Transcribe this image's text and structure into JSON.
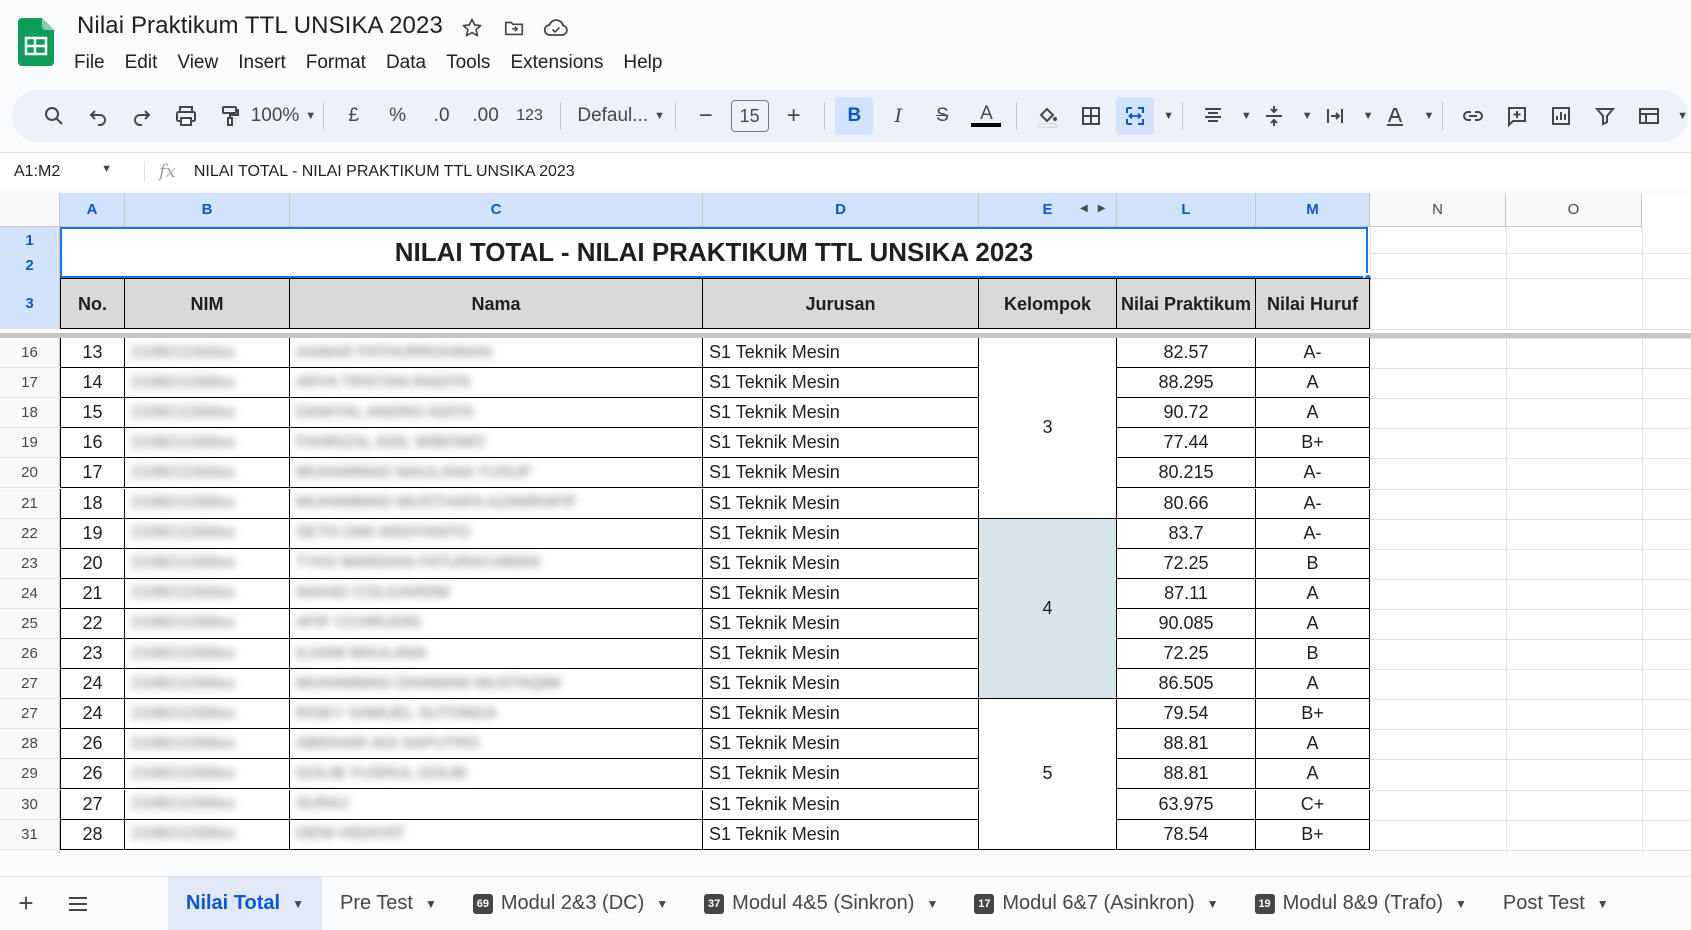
{
  "doc": {
    "title": "Nilai Praktikum TTL UNSIKA 2023",
    "menu": [
      "File",
      "Edit",
      "View",
      "Insert",
      "Format",
      "Data",
      "Tools",
      "Extensions",
      "Help"
    ]
  },
  "toolbar": {
    "zoom": "100%",
    "currency": "£",
    "percent": "%",
    "dec_decrease": ".0",
    "dec_increase": ".00",
    "number_format": "123",
    "font": "Defaul...",
    "font_size": "15",
    "minus": "−",
    "plus": "+",
    "bold": "B",
    "italic": "I",
    "strike": "S",
    "text_color": "A"
  },
  "formula_bar": {
    "name_box": "A1:M2",
    "fx": "fx",
    "content": "NILAI TOTAL - NILAI PRAKTIKUM TTL UNSIKA 2023"
  },
  "columns": [
    "A",
    "B",
    "C",
    "D",
    "E",
    "L",
    "M",
    "N",
    "O"
  ],
  "sheet": {
    "title": "NILAI TOTAL - NILAI PRAKTIKUM TTL UNSIKA 2023",
    "headers": [
      "No.",
      "NIM",
      "Nama",
      "Jurusan",
      "Kelompok",
      "Nilai Praktikum",
      "Nilai Huruf"
    ],
    "header_rows": [
      "1",
      "2",
      "3"
    ],
    "rows": [
      {
        "r": "16",
        "no": "13",
        "nim": "2108211500xx",
        "nama": "AAMAR FATHURROHMAN",
        "jurusan": "S1 Teknik Mesin",
        "nilai": "82.57",
        "huruf": "A-"
      },
      {
        "r": "17",
        "no": "14",
        "nim": "2108211500xx",
        "nama": "ARYA TRISTAN RADITA",
        "jurusan": "S1 Teknik Mesin",
        "nilai": "88.295",
        "huruf": "A"
      },
      {
        "r": "18",
        "no": "15",
        "nim": "2108211500xx",
        "nama": "DANIYAL ANDRO ADITA",
        "jurusan": "S1 Teknik Mesin",
        "nilai": "90.72",
        "huruf": "A"
      },
      {
        "r": "19",
        "no": "16",
        "nim": "2108211500xx",
        "nama": "FAHRIZAL ADIL WIBOWO",
        "jurusan": "S1 Teknik Mesin",
        "nilai": "77.44",
        "huruf": "B+"
      },
      {
        "r": "20",
        "no": "17",
        "nim": "2108211500xx",
        "nama": "MUHAMMAD MAULANA YUSUF",
        "jurusan": "S1 Teknik Mesin",
        "nilai": "80.215",
        "huruf": "A-"
      },
      {
        "r": "21",
        "no": "18",
        "nim": "2108211500xx",
        "nama": "MUHAMMAD MUSTHAFA AZAMRAFIF",
        "jurusan": "S1 Teknik Mesin",
        "nilai": "80.66",
        "huruf": "A-"
      },
      {
        "r": "22",
        "no": "19",
        "nim": "2108211500xx",
        "nama": "SETO DWI ARDIYANTO",
        "jurusan": "S1 Teknik Mesin",
        "nilai": "83.7",
        "huruf": "A-"
      },
      {
        "r": "23",
        "no": "20",
        "nim": "2108211500xx",
        "nama": "TYAS MARDIAN FATURACHMAN",
        "jurusan": "S1 Teknik Mesin",
        "nilai": "72.25",
        "huruf": "B"
      },
      {
        "r": "24",
        "no": "21",
        "nim": "2108211500xx",
        "nama": "WAHID COLIUARDM",
        "jurusan": "S1 Teknik Mesin",
        "nilai": "87.11",
        "huruf": "A"
      },
      {
        "r": "25",
        "no": "22",
        "nim": "2108211500xx",
        "nama": "AFIF CCHRUDIN",
        "jurusan": "S1 Teknik Mesin",
        "nilai": "90.085",
        "huruf": "A"
      },
      {
        "r": "26",
        "no": "23",
        "nim": "2108211500xx",
        "nama": "ILHAM MAULANA",
        "jurusan": "S1 Teknik Mesin",
        "nilai": "72.25",
        "huruf": "B"
      },
      {
        "r": "27",
        "no": "24",
        "nim": "2108211500xx",
        "nama": "MUHAMMAD DHAWANI MUSTAQIM",
        "jurusan": "S1 Teknik Mesin",
        "nilai": "86.505",
        "huruf": "A"
      },
      {
        "r": "27",
        "no": "24",
        "nim": "2108211500xx",
        "nama": "RISKY SAMUEL SUTONGA",
        "jurusan": "S1 Teknik Mesin",
        "nilai": "79.54",
        "huruf": "B+"
      },
      {
        "r": "28",
        "no": "26",
        "nim": "2108211500xx",
        "nama": "ABIDHAR ADI SAPUTRO",
        "jurusan": "S1 Teknik Mesin",
        "nilai": "88.81",
        "huruf": "A"
      },
      {
        "r": "29",
        "no": "26",
        "nim": "2108211500xx",
        "nama": "GOLIB YUSRUL GOLBI",
        "jurusan": "S1 Teknik Mesin",
        "nilai": "88.81",
        "huruf": "A"
      },
      {
        "r": "30",
        "no": "27",
        "nim": "2108211500xx",
        "nama": "SURAJ",
        "jurusan": "S1 Teknik Mesin",
        "nilai": "63.975",
        "huruf": "C+"
      },
      {
        "r": "31",
        "no": "28",
        "nim": "2108211500xx",
        "nama": "DENI HIDAYAT",
        "jurusan": "S1 Teknik Mesin",
        "nilai": "78.54",
        "huruf": "B+"
      }
    ],
    "kelompok": [
      {
        "label": "3",
        "start": 0,
        "count": 6,
        "color": "#ffffff"
      },
      {
        "label": "4",
        "start": 6,
        "count": 6,
        "color": "#d7e4e8"
      },
      {
        "label": "5",
        "start": 12,
        "count": 5,
        "color": "#ffffff"
      }
    ]
  },
  "tabs": [
    {
      "label": "Nilai Total",
      "badge": "",
      "active": true
    },
    {
      "label": "Pre Test",
      "badge": "",
      "active": false
    },
    {
      "label": "Modul 2&3 (DC)",
      "badge": "69",
      "active": false
    },
    {
      "label": "Modul 4&5 (Sinkron)",
      "badge": "37",
      "active": false
    },
    {
      "label": "Modul 6&7 (Asinkron)",
      "badge": "17",
      "active": false
    },
    {
      "label": "Modul 8&9 (Trafo)",
      "badge": "19",
      "active": false
    },
    {
      "label": "Post Test",
      "badge": "",
      "active": false
    }
  ],
  "colors": {
    "accent": "#0b57d0",
    "selection": "#1a73e8",
    "header_fill": "#d9d9d9",
    "group_fill": "#d7e4e8",
    "logo": "#0f9d58"
  }
}
